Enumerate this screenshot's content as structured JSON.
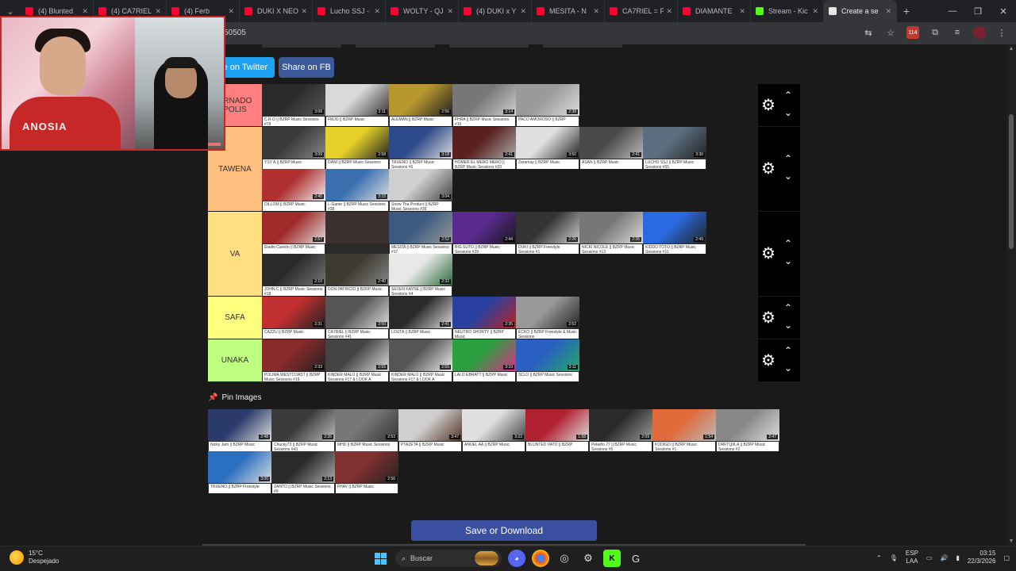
{
  "browser": {
    "tabs": [
      {
        "label": "(4) Blunted",
        "type": "yt"
      },
      {
        "label": "(4) CA7RIEL",
        "type": "yt"
      },
      {
        "label": "(4) Ferb",
        "type": "yt"
      },
      {
        "label": "DUKI X NEO",
        "type": "yt"
      },
      {
        "label": "Lucho SSJ - ",
        "type": "yt"
      },
      {
        "label": "WOLTY - QJ",
        "type": "yt"
      },
      {
        "label": "(4) DUKI x Y",
        "type": "yt"
      },
      {
        "label": "MESITA - N",
        "type": "yt"
      },
      {
        "label": "CA7RIEL = P",
        "type": "yt"
      },
      {
        "label": "DIAMANTE",
        "type": "yt"
      },
      {
        "label": "Stream - Kic",
        "type": "kick"
      },
      {
        "label": "Create a se",
        "type": "tier",
        "active": true
      }
    ],
    "url": "50505",
    "notif_count": "114"
  },
  "share": {
    "twitter": "are on Twitter",
    "facebook": "Share on FB"
  },
  "tiers": [
    {
      "label": "ERNADO POLIS",
      "color": "#ff7f7f",
      "items": [
        {
          "cap": "C.R.O || BZRP Music Sessions #78",
          "dur": "3:08",
          "c1": "#2b2b2b",
          "c2": "#555"
        },
        {
          "cap": "FMJO || BZRP Music",
          "dur": "2:11",
          "c1": "#d9d9d9",
          "c2": "#333"
        },
        {
          "cap": "ALEMÁN || BZRP Music",
          "dur": "2:56",
          "c1": "#b8962e",
          "c2": "#222"
        },
        {
          "cap": "FHRA || BZRP Music Sessions #16",
          "dur": "3:14",
          "c1": "#777",
          "c2": "#cfcfcf"
        },
        {
          "cap": "PACO AMOROSO || BZRP",
          "dur": "2:38",
          "c1": "#9a9a9a",
          "c2": "#ddd"
        }
      ]
    },
    {
      "label": "TAWENA",
      "color": "#ffbf7f",
      "items": [
        {
          "cap": "YSY A || BZRP Music",
          "dur": "3:09",
          "c1": "#3a3a3a",
          "c2": "#888"
        },
        {
          "cap": "DANI || BZRP Music Sessions",
          "dur": "2:58",
          "c1": "#e6d12a",
          "c2": "#222"
        },
        {
          "cap": "TRUENO || BZRP Music Sessions #6",
          "dur": "3:18",
          "c1": "#2d4a8a",
          "c2": "#ddd"
        },
        {
          "cap": "HOMER EL MERO MERO || BZRP Music Sessions #20",
          "dur": "2:41",
          "c1": "#5a2020",
          "c2": "#aaa"
        },
        {
          "cap": "Zaramay || BZRP Music",
          "dur": "3:50",
          "c1": "#e0e0e0",
          "c2": "#222"
        },
        {
          "cap": "ASAN || BZRP Music",
          "dur": "2:41",
          "c1": "#4a4a4a",
          "c2": "#bbb"
        },
        {
          "cap": "LUCHO SSJ || BZRP Music Sessions #55",
          "dur": "3:30",
          "c1": "#5b6e80",
          "c2": "#222"
        },
        {
          "cap": "DILLOM || BZRP Music",
          "dur": "2:45",
          "c1": "#b03030",
          "c2": "#eee"
        },
        {
          "cap": "L-Gante || BZRP Music Sessions #38",
          "dur": "3:15",
          "c1": "#3a70b0",
          "c2": "#ddd"
        },
        {
          "cap": "Snow Tha Product || BZRP Music Sessions #39",
          "dur": "3:04",
          "c1": "#cfcfcf",
          "c2": "#444"
        }
      ]
    },
    {
      "label": "VA",
      "color": "#ffdf7f",
      "items": [
        {
          "cap": "Eladio Carrión || BZRP Music",
          "dur": "2:57",
          "c1": "#a02a2a",
          "c2": "#ddd"
        },
        {
          "cap": "",
          "dur": "",
          "c1": "#3a3030",
          "c2": "#3a3030"
        },
        {
          "cap": "MESITA || BZRP Music Sessions #17",
          "dur": "2:52",
          "c1": "#3a5a80",
          "c2": "#999"
        },
        {
          "cap": "BIG SUTO || BZRP Music Sessions #29",
          "dur": "2:44",
          "c1": "#5a2a90",
          "c2": "#1a1a1a"
        },
        {
          "cap": "DUKI || BZRP Freestyle Sessions #1",
          "dur": "2:26",
          "c1": "#333",
          "c2": "#ccc"
        },
        {
          "cap": "NICKI NICOLE || BZRP Music Sessions #13",
          "dur": "2:26",
          "c1": "#777",
          "c2": "#ddd"
        },
        {
          "cap": "KIDDO TOTO || BZRP Music Sessions #11",
          "dur": "2:49",
          "c1": "#2a6ae0",
          "c2": "#222"
        },
        {
          "cap": "JOHN C || BZRP Music Sessions #18",
          "dur": "2:10",
          "c1": "#2a2a2a",
          "c2": "#777"
        },
        {
          "cap": "DON PATRICIO || BZRP Music",
          "dur": "2:40",
          "c1": "#3d3a30",
          "c2": "#888"
        },
        {
          "cap": "SEVEN KAYNE || BZRP Music Sessions #4",
          "dur": "2:32",
          "c1": "#e8e8e8",
          "c2": "#2a6a3a"
        }
      ]
    },
    {
      "label": "SAFA",
      "color": "#ffff7f",
      "items": [
        {
          "cap": "CAZZU || BZRP Music",
          "dur": "2:31",
          "c1": "#c03030",
          "c2": "#222"
        },
        {
          "cap": "CA7RIEL || BZRP Music Sessions #41",
          "dur": "2:50",
          "c1": "#555",
          "c2": "#ddd"
        },
        {
          "cap": "LOUTA || BZRP Music",
          "dur": "2:41",
          "c1": "#2a2a2a",
          "c2": "#ddd"
        },
        {
          "cap": "NEUTRO SHORTY || BZRP Music",
          "dur": "2:35",
          "c1": "#2a40a0",
          "c2": "#c02020"
        },
        {
          "cap": "ECKO || BZRP Freestyle & Music Sessions",
          "dur": "2:52",
          "c1": "#999",
          "c2": "#222"
        }
      ]
    },
    {
      "label": "UNAKA",
      "color": "#bfff7f",
      "items": [
        {
          "cap": "POLIMA WESTCOAST || BZRP Music Sessions #19",
          "dur": "2:33",
          "c1": "#8a2a2a",
          "c2": "#222"
        },
        {
          "cap": "KINDER MALO || BZRP Music Sessions #17 & LOOK A",
          "dur": "2:55",
          "c1": "#444",
          "c2": "#ddd"
        },
        {
          "cap": "KINDER MALO || BZRP Music Sessions #17 & LOOK A",
          "dur": "2:55",
          "c1": "#555",
          "c2": "#eee"
        },
        {
          "cap": "LALO EBRATT || BZRP Music",
          "dur": "3:10",
          "c1": "#2aa040",
          "c2": "#e02a8a"
        },
        {
          "cap": "3CLO || BZRP Music Sessions",
          "dur": "3:11",
          "c1": "#2a60c0",
          "c2": "#22aa66"
        }
      ]
    }
  ],
  "pin": {
    "title": "Pin Images",
    "items": [
      {
        "cap": "Nicky Jam || BZRP Music",
        "dur": "2:48",
        "c1": "#2a3a6a",
        "c2": "#ddd"
      },
      {
        "cap": "Chucky73 || BZRP Music Sessions #43",
        "dur": "2:35",
        "c1": "#3a3a3a",
        "c2": "#bbb"
      },
      {
        "cap": "MHD || BZRP Music Sessions",
        "dur": "2:53",
        "c1": "#777",
        "c2": "#333"
      },
      {
        "cap": "PTAZETA || BZRP Music",
        "dur": "3:47",
        "c1": "#cfcfcf",
        "c2": "#553322"
      },
      {
        "cap": "ANUEL AA || BZRP Music",
        "dur": "3:22",
        "c1": "#e0e0e0",
        "c2": "#444"
      },
      {
        "cap": "BLUNTED VATO || BZRP",
        "dur": "1:58",
        "c1": "#b02030",
        "c2": "#ddd"
      },
      {
        "cap": "Pekeño 77 || BZRP Music Sessions #5",
        "dur": "2:09",
        "c1": "#2a2a2a",
        "c2": "#999"
      },
      {
        "cap": "KODIGO || BZRP Music Sessions #1",
        "dur": "1:54",
        "c1": "#e06a3a",
        "c2": "#bbb"
      },
      {
        "cap": "DRFTQIK A || BZRP Music Sessions #2",
        "dur": "2:47",
        "c1": "#888",
        "c2": "#ddd"
      },
      {
        "cap": "TRUENO || BZRP Freestyle",
        "dur": "3:00",
        "c1": "#2a70c0",
        "c2": "#ddd"
      },
      {
        "cap": "ZANTO || BZRP Music Sessions #9",
        "dur": "2:13",
        "c1": "#2a2a2a",
        "c2": "#aaa"
      },
      {
        "cap": "FHAV || BZRP Music",
        "dur": "2:56",
        "c1": "#803030",
        "c2": "#222"
      }
    ]
  },
  "save_label": "Save or Download",
  "webcam": {
    "shirt_text": "ANOSIA"
  },
  "taskbar": {
    "temp": "15°C",
    "weather": "Despejado",
    "search": "Buscar",
    "lang1": "ESP",
    "lang2": "LAA",
    "time": "03:15",
    "date": "22/3/2026"
  }
}
